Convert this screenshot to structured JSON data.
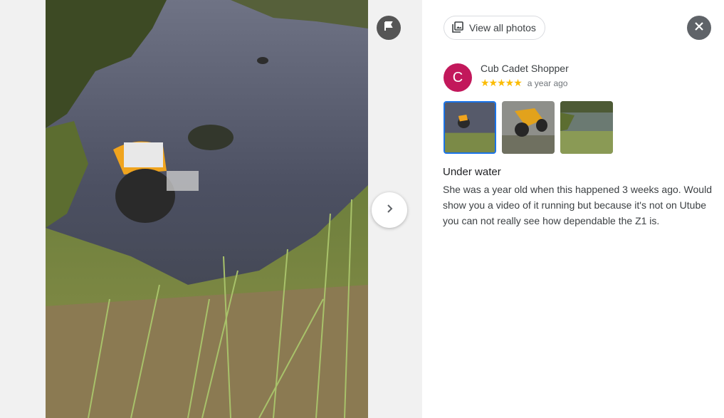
{
  "viewer": {
    "photo_description": "",
    "flag_icon": "flag-icon",
    "next_icon": "chevron-right-icon"
  },
  "panel": {
    "view_all_label": "View all photos",
    "view_all_icon": "photo-library-icon",
    "close_icon": "close-icon",
    "author": {
      "initial": "C",
      "name": "Cub Cadet Shopper",
      "avatar_color": "#c2185b",
      "stars": "★★★★★",
      "rating": 5,
      "time": "a year ago"
    },
    "thumbnails": [
      {
        "name": "thumbnail-1",
        "selected": true
      },
      {
        "name": "thumbnail-2",
        "selected": false
      },
      {
        "name": "thumbnail-3",
        "selected": false
      }
    ],
    "caption": "Under water",
    "review": "She was a year old when this happened 3 weeks ago. Would show you a video of it running but because it's not on Utube you can not really see how dependable the Z1 is."
  },
  "colors": {
    "accent": "#1a73e8",
    "star": "#fbbc04"
  }
}
